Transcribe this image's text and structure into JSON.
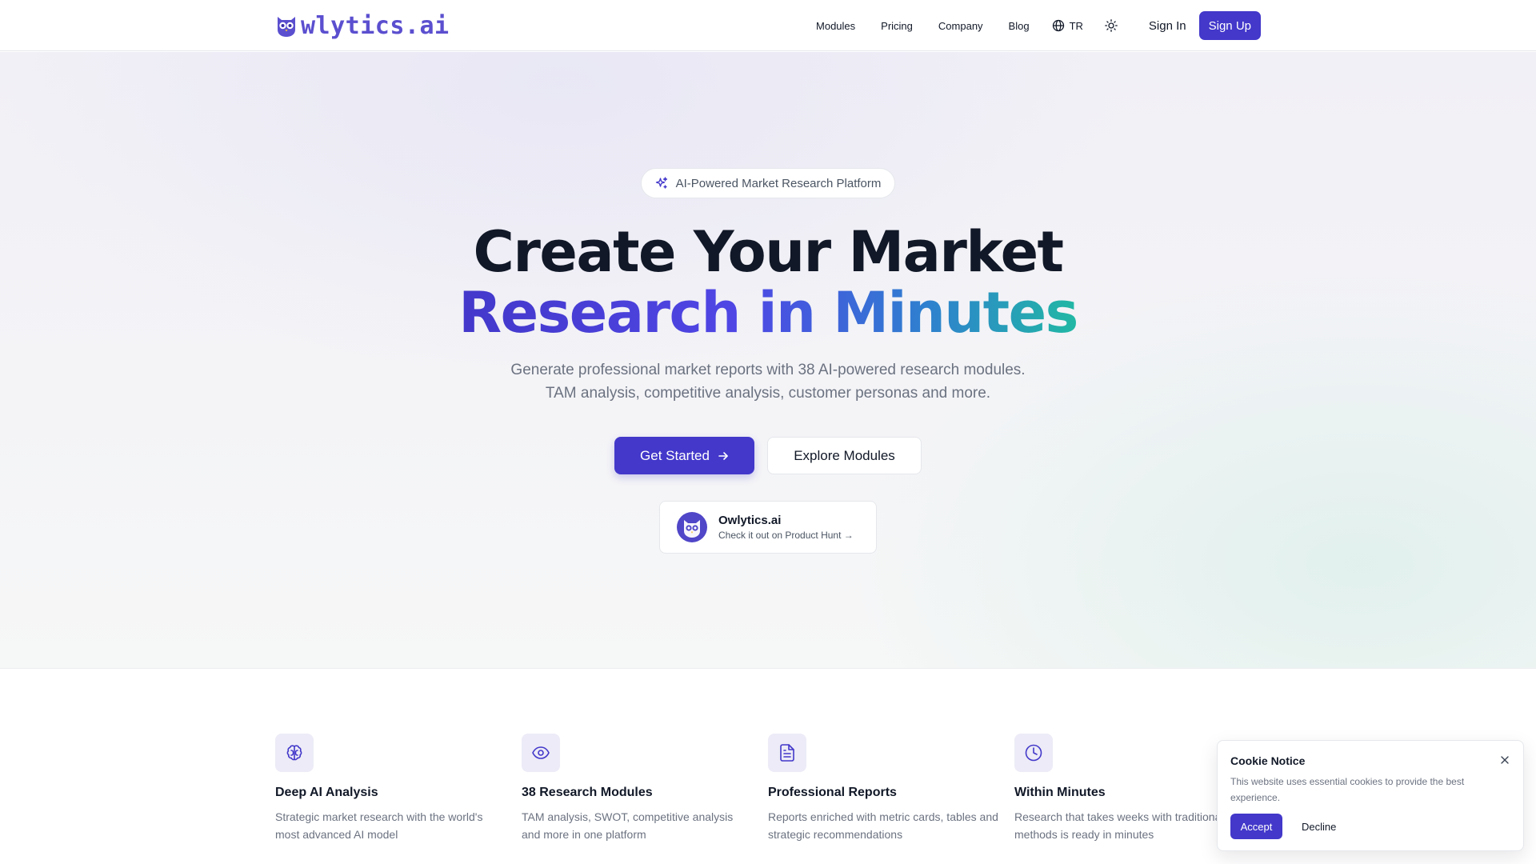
{
  "header": {
    "logo_text": "wlytics.ai",
    "nav": [
      "Modules",
      "Pricing",
      "Company",
      "Blog"
    ],
    "language": "TR",
    "sign_in": "Sign In",
    "sign_up": "Sign Up"
  },
  "hero": {
    "badge": "AI-Powered Market Research Platform",
    "title_line1": "Create Your Market",
    "title_line2": "Research in Minutes",
    "subtitle_line1": "Generate professional market reports with 38 AI-powered research modules.",
    "subtitle_line2": "TAM analysis, competitive analysis, customer personas and more.",
    "cta_primary": "Get Started",
    "cta_secondary": "Explore Modules",
    "product_hunt": {
      "name": "Owlytics.ai",
      "tagline": "Check it out on Product Hunt →"
    }
  },
  "features": [
    {
      "icon": "brain-icon",
      "title": "Deep AI Analysis",
      "desc": "Strategic market research with the world's most advanced AI model"
    },
    {
      "icon": "eye-icon",
      "title": "38 Research Modules",
      "desc": "TAM analysis, SWOT, competitive analysis and more in one platform"
    },
    {
      "icon": "document-icon",
      "title": "Professional Reports",
      "desc": "Reports enriched with metric cards, tables and strategic recommendations"
    },
    {
      "icon": "clock-icon",
      "title": "Within Minutes",
      "desc": "Research that takes weeks with traditional methods is ready in minutes"
    }
  ],
  "cookie": {
    "title": "Cookie Notice",
    "text": "This website uses essential cookies to provide the best experience.",
    "accept": "Accept",
    "decline": "Decline"
  },
  "colors": {
    "brand": "#4338ca",
    "brand_light": "#5b4fcf",
    "gradient_end": "#21b8a4",
    "icon_bg": "#ecebf7"
  }
}
